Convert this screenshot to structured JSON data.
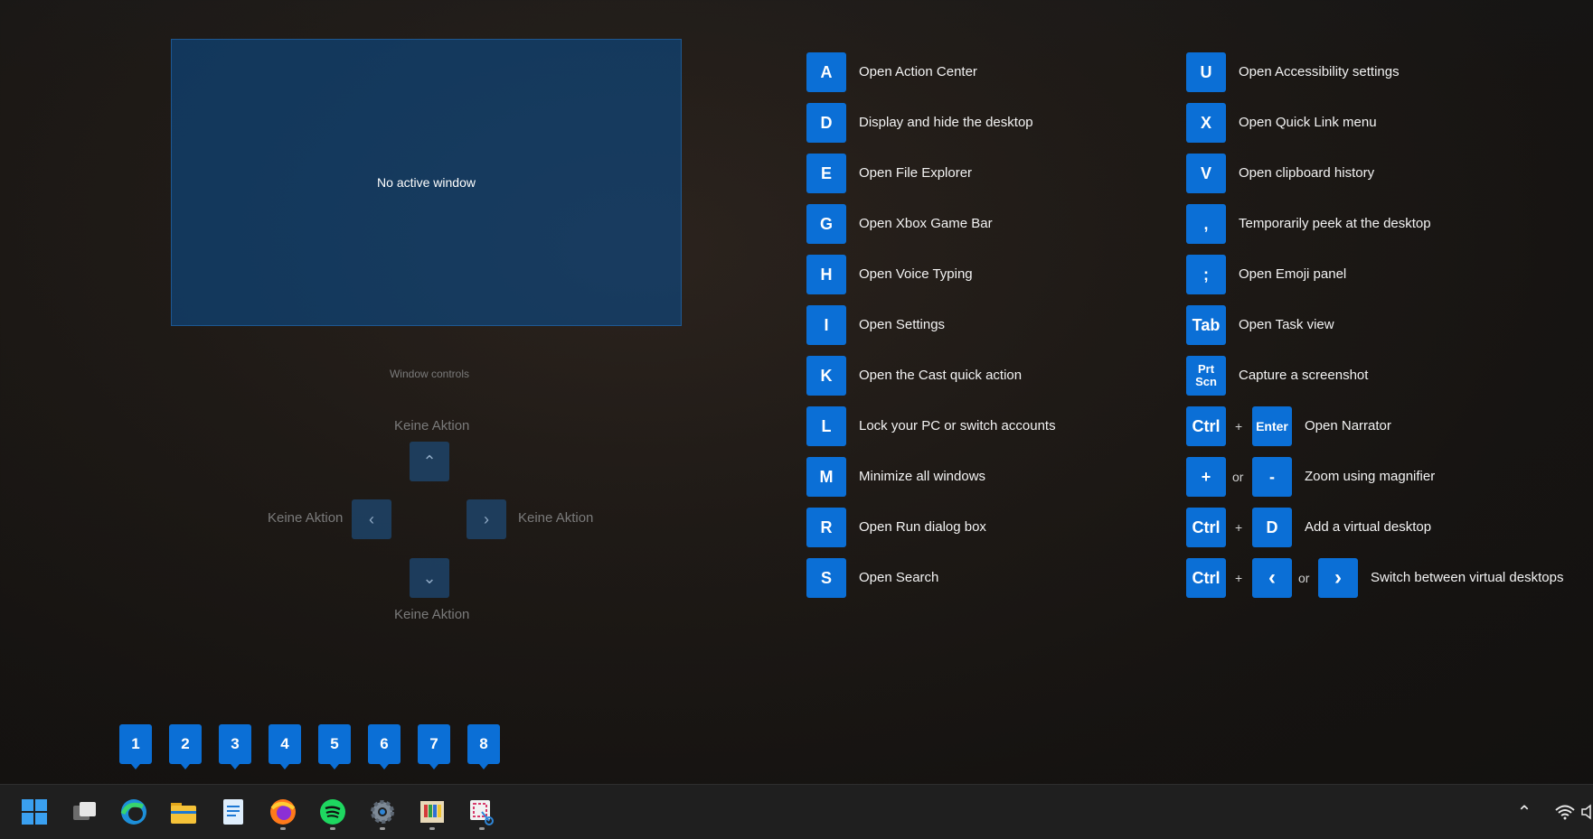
{
  "preview": {
    "text": "No active window"
  },
  "window_controls": {
    "title": "Window controls",
    "up_label": "Keine Aktion",
    "left_label": "Keine Aktion",
    "right_label": "Keine Aktion",
    "down_label": "Keine Aktion"
  },
  "shortcuts_left": [
    {
      "key": "A",
      "label": "Open Action Center"
    },
    {
      "key": "D",
      "label": "Display and hide the desktop"
    },
    {
      "key": "E",
      "label": "Open File Explorer"
    },
    {
      "key": "G",
      "label": "Open Xbox Game Bar"
    },
    {
      "key": "H",
      "label": "Open Voice Typing"
    },
    {
      "key": "I",
      "label": "Open Settings"
    },
    {
      "key": "K",
      "label": "Open the Cast quick action"
    },
    {
      "key": "L",
      "label": "Lock your PC or switch accounts"
    },
    {
      "key": "M",
      "label": "Minimize all windows"
    },
    {
      "key": "R",
      "label": "Open Run dialog box"
    },
    {
      "key": "S",
      "label": "Open Search"
    }
  ],
  "shortcuts_right": [
    {
      "key": "U",
      "label": "Open Accessibility settings"
    },
    {
      "key": "X",
      "label": "Open Quick Link menu"
    },
    {
      "key": "V",
      "label": "Open clipboard history"
    },
    {
      "key": ",",
      "label": "Temporarily peek at the desktop"
    },
    {
      "key": ";",
      "label": "Open Emoji panel"
    },
    {
      "key": "Tab",
      "label": "Open Task view"
    },
    {
      "key": "Prt Scn",
      "label": "Capture a screenshot"
    }
  ],
  "combos": {
    "narrator": {
      "k1": "Ctrl",
      "sep": "+",
      "k2": "Enter",
      "label": "Open Narrator"
    },
    "magnifier": {
      "k1": "+",
      "sep": "or",
      "k2": "-",
      "label": "Zoom using magnifier"
    },
    "vdesk": {
      "k1": "Ctrl",
      "sep": "+",
      "k2": "D",
      "label": "Add a virtual desktop"
    },
    "switch": {
      "k1": "Ctrl",
      "sep1": "+",
      "k2": "‹",
      "sep2": "or",
      "k3": "›",
      "label": "Switch between virtual desktops"
    }
  },
  "taskbar_numbers": [
    "1",
    "2",
    "3",
    "4",
    "5",
    "6",
    "7",
    "8"
  ],
  "taskbar_icons": [
    "windows-start-icon",
    "task-view-icon",
    "edge-icon",
    "file-explorer-icon",
    "notepad-icon",
    "firefox-icon",
    "spotify-icon",
    "settings-icon",
    "paint-icon",
    "snipping-tool-icon"
  ],
  "colors": {
    "accent": "#0b6fd6",
    "taskbar": "#1f1f1f"
  }
}
